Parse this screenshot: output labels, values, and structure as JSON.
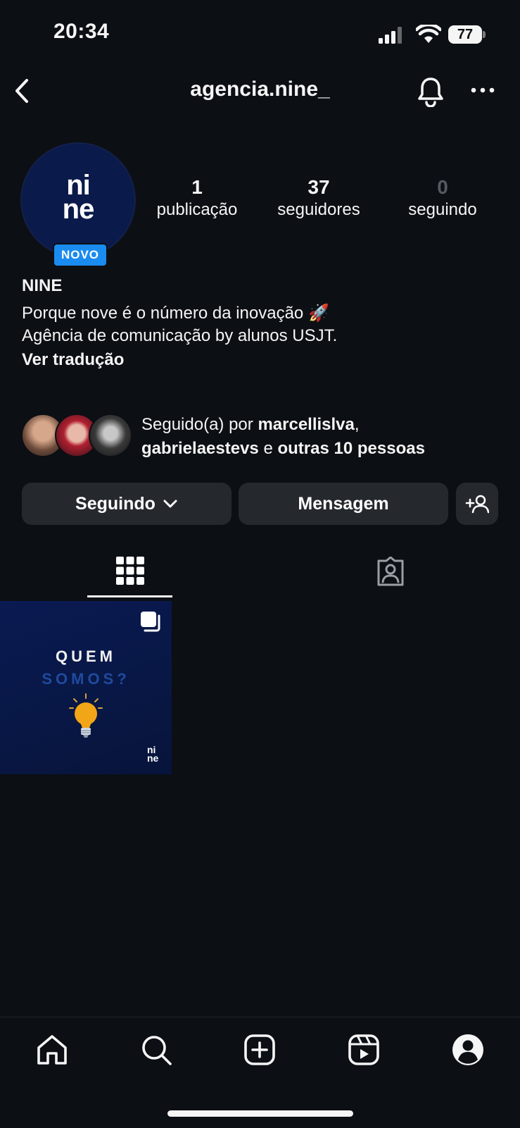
{
  "status_bar": {
    "time": "20:34",
    "battery": "77"
  },
  "header": {
    "username": "agencia.nine_"
  },
  "profile": {
    "avatar_logo_line1": "ni",
    "avatar_logo_line2": "ne",
    "badge": "NOVO",
    "stats": [
      {
        "value": "1",
        "label": "publicação"
      },
      {
        "value": "37",
        "label": "seguidores"
      },
      {
        "value": "0",
        "label": "seguindo"
      }
    ],
    "name": "NINE",
    "bio_line1": "Porque nove é o número da inovação 🚀",
    "bio_line2": "Agência de comunicação by alunos USJT.",
    "translate_link": "Ver tradução"
  },
  "followed_by": {
    "prefix": "Seguido(a) por",
    "user1": "marcellislva",
    "user2": "gabrielaestevs",
    "conjunction": "e",
    "others": "outras 10 pessoas"
  },
  "actions": {
    "following": "Seguindo",
    "message": "Mensagem"
  },
  "post": {
    "line1": "QUEM",
    "line2": "SOMOS?",
    "logo_line1": "ni",
    "logo_line2": "ne"
  },
  "colors": {
    "background": "#0c0f14",
    "button": "#25292e",
    "badge": "#1a8cf0",
    "post_bg": "#0a1a52"
  }
}
